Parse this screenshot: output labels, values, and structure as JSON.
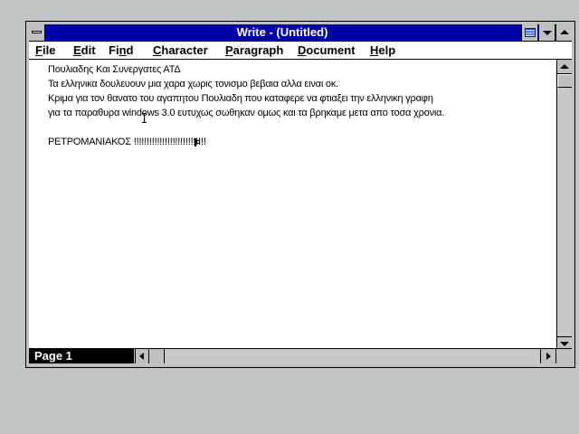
{
  "window": {
    "title": "Write - (Untitled)"
  },
  "menu": {
    "file": {
      "acc": "F",
      "rest": "ile"
    },
    "edit": {
      "acc": "E",
      "rest": "dit"
    },
    "find": {
      "pre": "Fi",
      "acc": "n",
      "rest": "d"
    },
    "character": {
      "acc": "C",
      "rest": "haracter"
    },
    "paragraph": {
      "acc": "P",
      "rest": "aragraph"
    },
    "document": {
      "acc": "D",
      "rest": "ocument"
    },
    "help": {
      "acc": "H",
      "rest": "elp"
    }
  },
  "document": {
    "lines": [
      "Πουλιαδης Και Συνεργατες ΑΤΔ",
      "Τα ελληνικα δουλευουν μια χαρα χωρις τονισμο βεβαια αλλα ειναι οκ.",
      "Κριμα για τον θανατο του αγαπητου Πουλιαδη που καταφερε να φτιαξει την ελληνικη γραφη",
      "για τα παραθυρα windows 3.0 ευτυχως σωθηκαν ομως και τα βρηκαμε μετα απο τοσα χρονια.",
      "",
      "ΡΕΤΡΟΜΑΝΙΑΚΟΣ !!!!!!!!!!!!!!!!!!!!!!!!!!!!"
    ]
  },
  "status": {
    "page": "Page 1"
  },
  "icons": {
    "system_menu": "system-menu-icon",
    "language": "greek-keyboard-flag-icon",
    "minimize": "minimize-arrow-icon",
    "maximize": "maximize-arrow-icon"
  },
  "colors": {
    "title_bar": "#0000a8",
    "desktop": "#c0c4c4"
  }
}
